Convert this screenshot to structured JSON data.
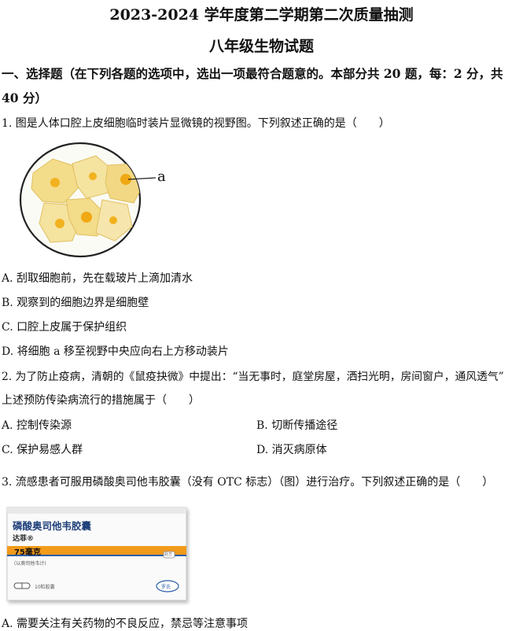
{
  "header": {
    "title": "2023-2024 学年度第二学期第二次质量抽测",
    "subtitle": "八年级生物试题"
  },
  "section1": {
    "line1": "一、选择题（在下列各题的选项中，选出一项最符合题意的。本部分共 20 题，每：2 分，共",
    "line2": "40 分）"
  },
  "q1": {
    "stem": "1. 图是人体口腔上皮细胞临时装片显微镜的视野图。下列叙述正确的是（　　）",
    "figure_label": "a",
    "options": [
      "A. 刮取细胞前，先在载玻片上滴加清水",
      "B. 观察到的细胞边界是细胞壁",
      "C. 口腔上皮属于保护组织",
      "D. 将细胞 a 移至视野中央应向右上方移动装片"
    ]
  },
  "q2": {
    "stem1": "2. 为了防止疫病，清朝的《鼠疫抉微》中提出：“当无事时，庭堂房屋，洒扫光明，房间窗户，通风透气”",
    "stem2": "上述预防传染病流行的措施属于（　　）",
    "options": [
      "A. 控制传染源",
      "B. 切断传播途径",
      "C. 保护易感人群",
      "D. 消灭病原体"
    ]
  },
  "q3": {
    "stem": "3. 流感患者可服用磷酸奥司他韦胶囊（没有 OTC 标志）（图）进行治疗。下列叙述正确的是（　　）",
    "box": {
      "drug_name": "磷酸奥司他韦胶囊",
      "brand": "达菲®",
      "dose": "75毫克",
      "dose_note": "(以奥司他韦计)",
      "count": "10粒胶囊",
      "maker": "罗氏",
      "corner_tag": "处方"
    },
    "option_a": "A. 需要关注有关药物的不良反应，禁忌等注意事项"
  },
  "colors": {
    "cell_fill": "#f3dc8a",
    "cell_nucleus": "#f2b21f",
    "box_stripe": "#f29a1a",
    "box_blue": "#2b5ea8"
  }
}
